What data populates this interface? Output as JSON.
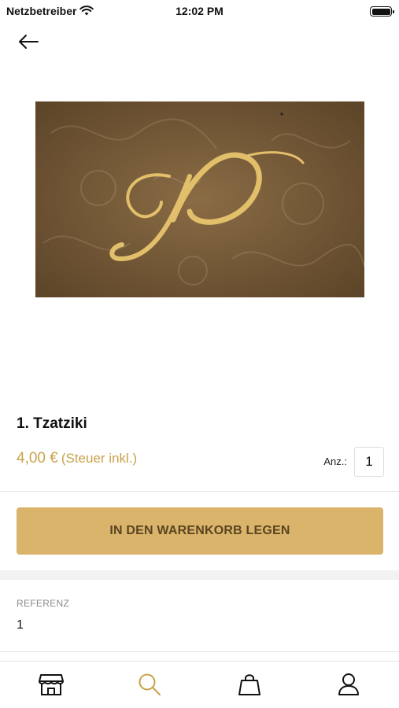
{
  "status_bar": {
    "carrier": "Netzbetreiber",
    "time": "12:02 PM"
  },
  "product": {
    "title": "1. Tzatziki",
    "price": "4,00 €",
    "tax_note": "(Steuer inkl.)"
  },
  "quantity": {
    "label": "Anz.:",
    "value": "1"
  },
  "cart_button": {
    "label": "IN DEN WARENKORB LEGEN"
  },
  "reference": {
    "label": "REFERENZ",
    "value": "1"
  },
  "colors": {
    "accent": "#d9b46a",
    "price": "#c9a24a",
    "image_bg": "#6e5433",
    "logo_gold": "#e2bf6a"
  },
  "tabs": [
    {
      "icon": "store-icon",
      "active": false
    },
    {
      "icon": "search-icon",
      "active": true
    },
    {
      "icon": "shopping-bag-icon",
      "active": false
    },
    {
      "icon": "user-icon",
      "active": false
    }
  ]
}
